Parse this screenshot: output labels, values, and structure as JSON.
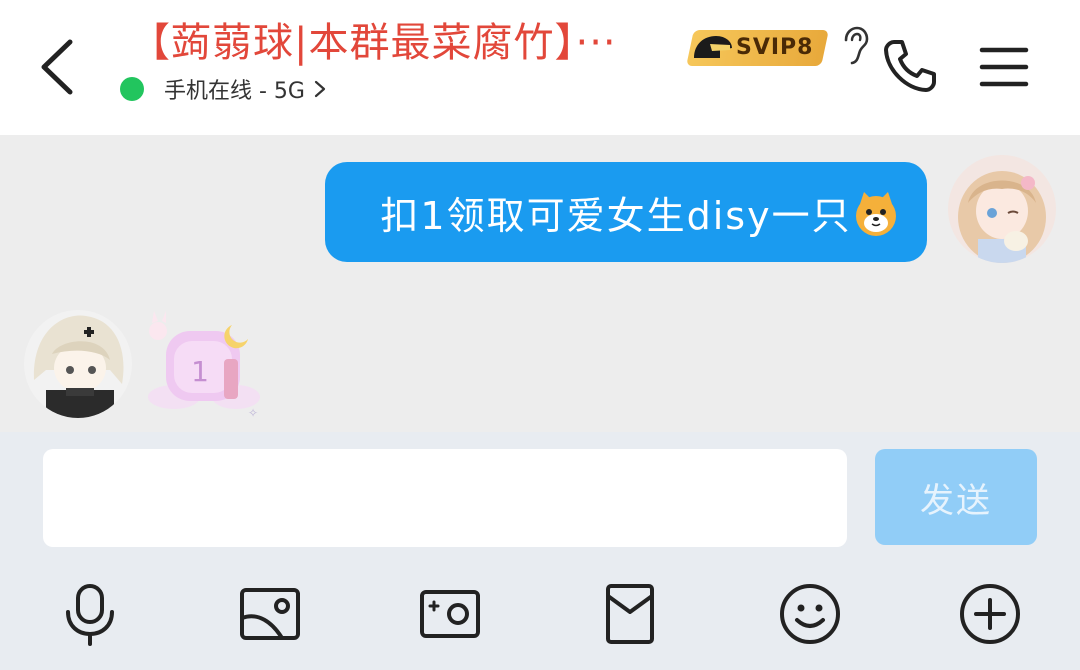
{
  "header": {
    "title": "【蒟蒻球|本群最菜腐竹】···",
    "status": "手机在线 - 5G",
    "vip_label": "SVIP8"
  },
  "messages": [
    {
      "direction": "out",
      "text": "扣1领取可爱女生disy一只",
      "emoji": "dog-face-emoji"
    },
    {
      "direction": "in",
      "type": "sticker",
      "sticker_glyph": "1"
    }
  ],
  "composer": {
    "input_value": "",
    "send_label": "发送"
  },
  "toolbar": [
    "microphone-icon",
    "image-icon",
    "camera-icon",
    "red-packet-icon",
    "emoji-icon",
    "plus-icon"
  ],
  "colors": {
    "bubble": "#1a9bf0",
    "title": "#e2473a",
    "online": "#22c55e",
    "send": "#91cdf7"
  }
}
